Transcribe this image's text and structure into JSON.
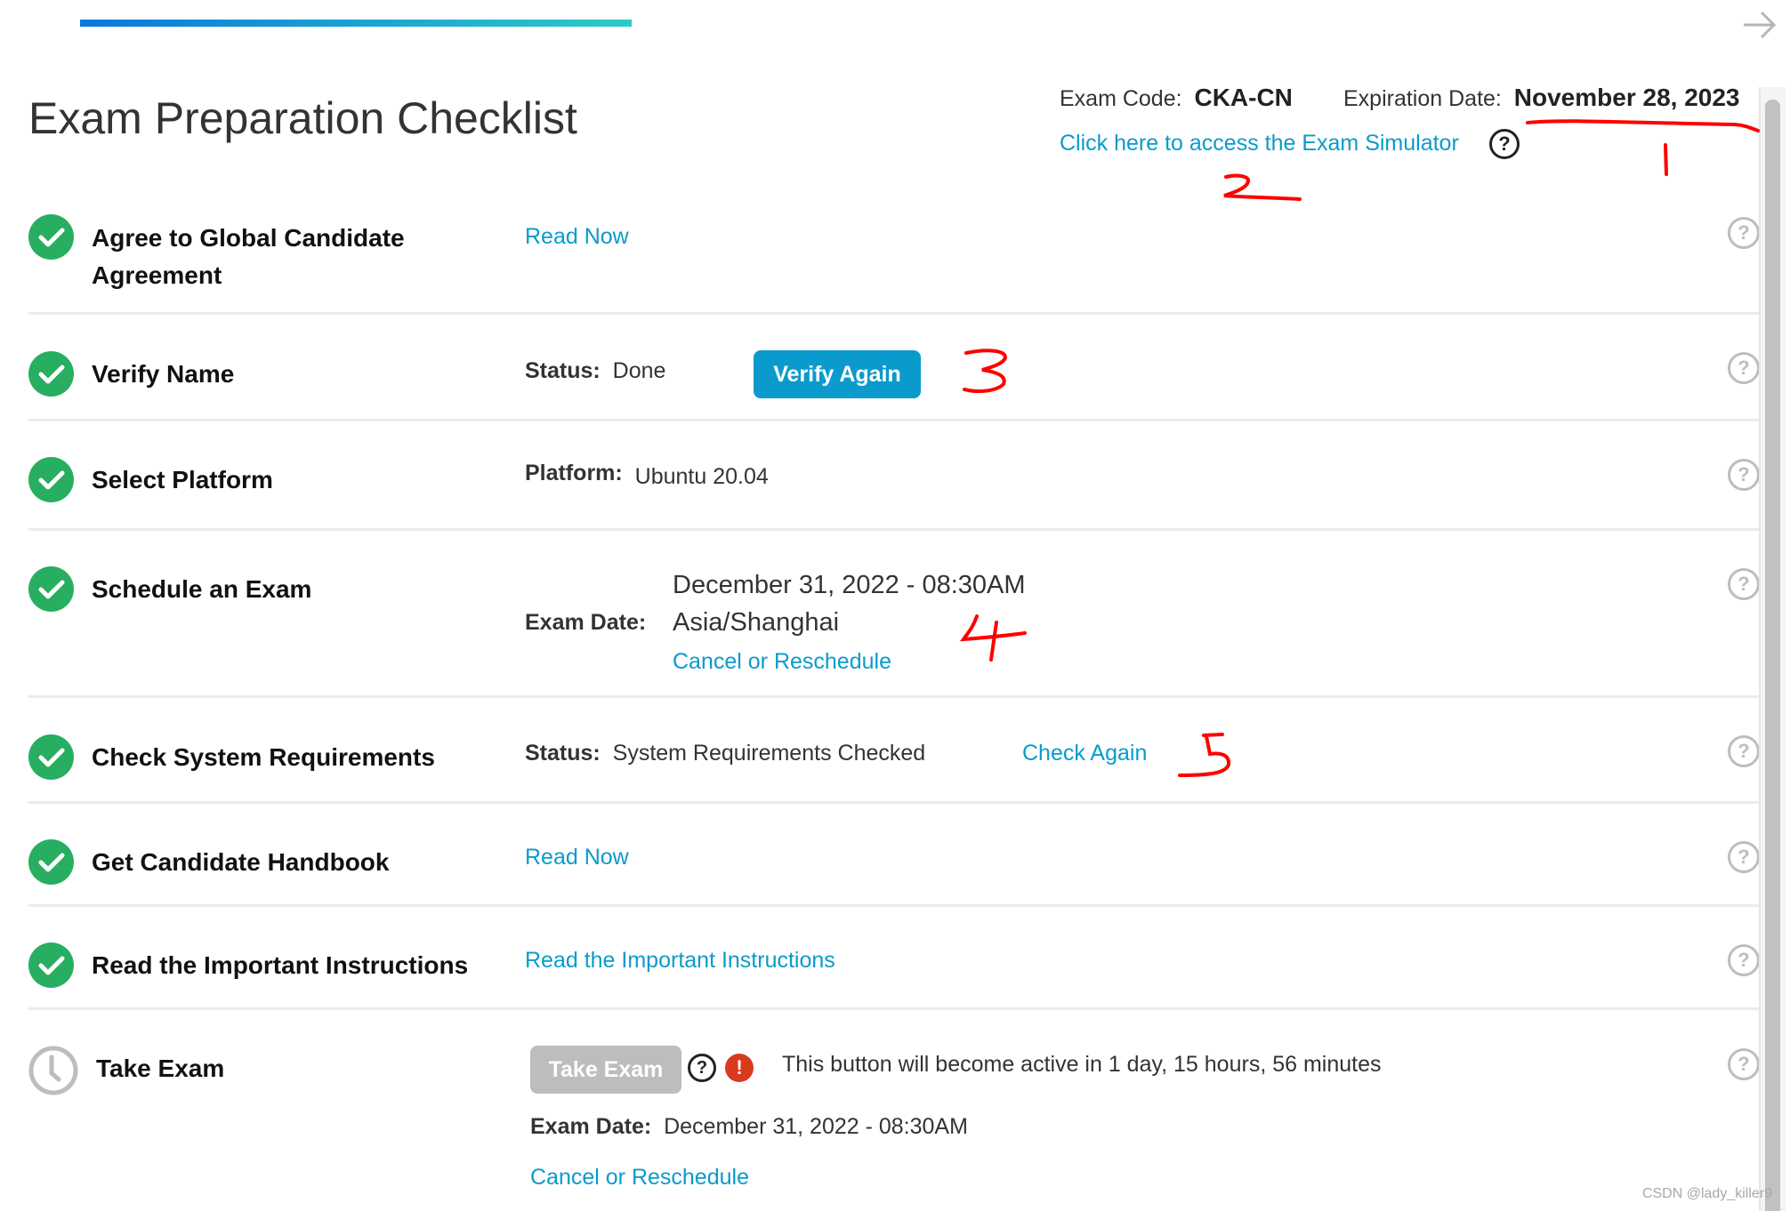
{
  "page": {
    "title": "Exam Preparation Checklist",
    "progress_fraction": null,
    "next_icon": "arrow-right-icon"
  },
  "header": {
    "exam_code_label": "Exam Code:",
    "exam_code_value": "CKA-CN",
    "expiration_label": "Expiration Date:",
    "expiration_value": "November 28, 2023",
    "simulator_link": "Click here to access the Exam Simulator",
    "help_glyph": "?"
  },
  "rows": [
    {
      "status": "complete",
      "title_line1": "Agree to Global Candidate",
      "title_line2": "Agreement",
      "link": "Read Now"
    },
    {
      "status": "complete",
      "title": "Verify Name",
      "status_label": "Status:",
      "status_value": "Done",
      "button": "Verify Again"
    },
    {
      "status": "complete",
      "title": "Select Platform",
      "platform_label": "Platform:",
      "platform_value": "Ubuntu 20.04"
    },
    {
      "status": "complete",
      "title": "Schedule an Exam",
      "date_label": "Exam Date:",
      "date_value": "December 31, 2022 - 08:30AM",
      "timezone": "Asia/Shanghai",
      "link": "Cancel or Reschedule"
    },
    {
      "status": "complete",
      "title": "Check System Requirements",
      "status_label": "Status:",
      "status_value": "System Requirements Checked",
      "link": "Check Again"
    },
    {
      "status": "complete",
      "title": "Get Candidate Handbook",
      "link": "Read Now"
    },
    {
      "status": "complete",
      "title": "Read the Important Instructions",
      "link": "Read the Important Instructions"
    },
    {
      "status": "pending",
      "title": "Take Exam",
      "button": "Take Exam",
      "button_state": "disabled",
      "alert_glyph": "!",
      "countdown_text": "This button will become active in 1 day, 15 hours, 56 minutes",
      "date_label": "Exam Date:",
      "date_value": "December 31, 2022 - 08:30AM",
      "link": "Cancel or Reschedule"
    }
  ],
  "annotations": [
    "1",
    "2",
    "3",
    "4",
    "5"
  ],
  "colors": {
    "accent": "#0a9bcc",
    "success": "#27ae60",
    "alert": "#d9391c",
    "disabled": "#bdbdbd",
    "annotation": "#ff0000"
  },
  "watermark": "CSDN @lady_killer9"
}
